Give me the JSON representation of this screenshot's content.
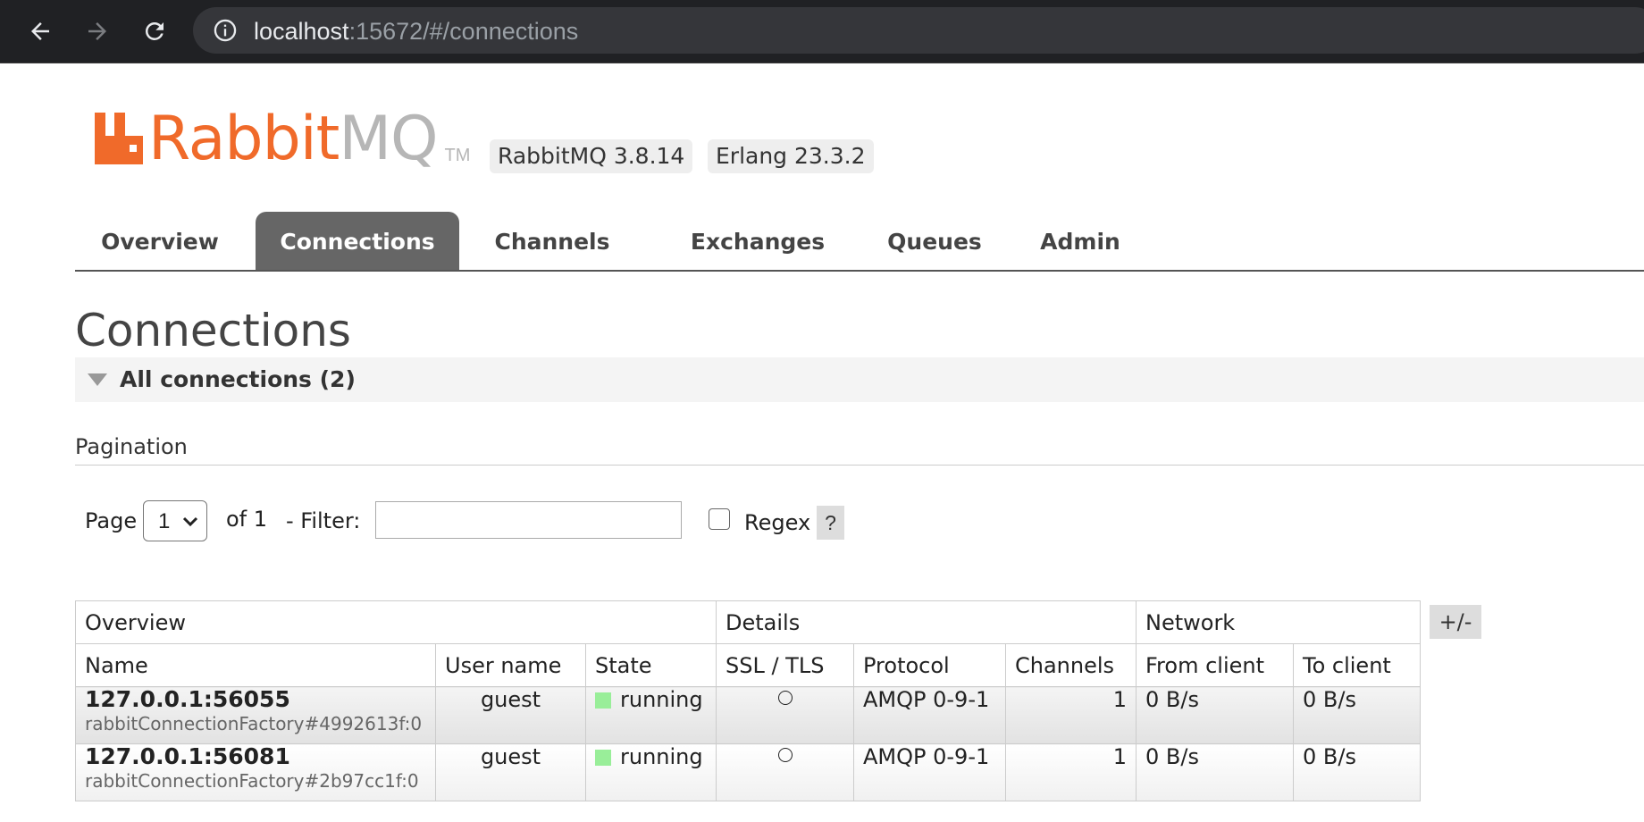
{
  "browser": {
    "url_host": "localhost",
    "url_rest": ":15672/#/connections"
  },
  "header": {
    "logo_rabbit": "Rabbit",
    "logo_mq": "MQ",
    "logo_tm": "TM",
    "rabbitmq_version": "RabbitMQ 3.8.14",
    "erlang_version": "Erlang 23.3.2"
  },
  "tabs": [
    {
      "label": "Overview",
      "active": false
    },
    {
      "label": "Connections",
      "active": true
    },
    {
      "label": "Channels",
      "active": false
    },
    {
      "label": "Exchanges",
      "active": false
    },
    {
      "label": "Queues",
      "active": false
    },
    {
      "label": "Admin",
      "active": false
    }
  ],
  "page": {
    "title": "Connections",
    "section_title": "All connections (2)"
  },
  "pagination": {
    "heading": "Pagination",
    "page_label": "Page",
    "page_value": "1",
    "of_label": "of 1",
    "filter_label": "- Filter:",
    "filter_value": "",
    "regex_label": "Regex",
    "regex_checked": false,
    "help_label": "?"
  },
  "table": {
    "groups": [
      "Overview",
      "Details",
      "Network"
    ],
    "columns": [
      "Name",
      "User name",
      "State",
      "SSL / TLS",
      "Protocol",
      "Channels",
      "From client",
      "To client"
    ],
    "plus_minus": "+/-",
    "rows": [
      {
        "name": "127.0.0.1:56055",
        "client": "rabbitConnectionFactory#4992613f:0",
        "user": "guest",
        "state": "running",
        "ssl": "○",
        "protocol": "AMQP 0-9-1",
        "channels": "1",
        "from_client": "0 B/s",
        "to_client": "0 B/s"
      },
      {
        "name": "127.0.0.1:56081",
        "client": "rabbitConnectionFactory#2b97cc1f:0",
        "user": "guest",
        "state": "running",
        "ssl": "○",
        "protocol": "AMQP 0-9-1",
        "channels": "1",
        "from_client": "0 B/s",
        "to_client": "0 B/s"
      }
    ]
  },
  "colors": {
    "brand_orange": "#f06a2a",
    "brand_gray": "#b6b6b6",
    "active_tab": "#666666",
    "state_running": "#99ee99"
  }
}
